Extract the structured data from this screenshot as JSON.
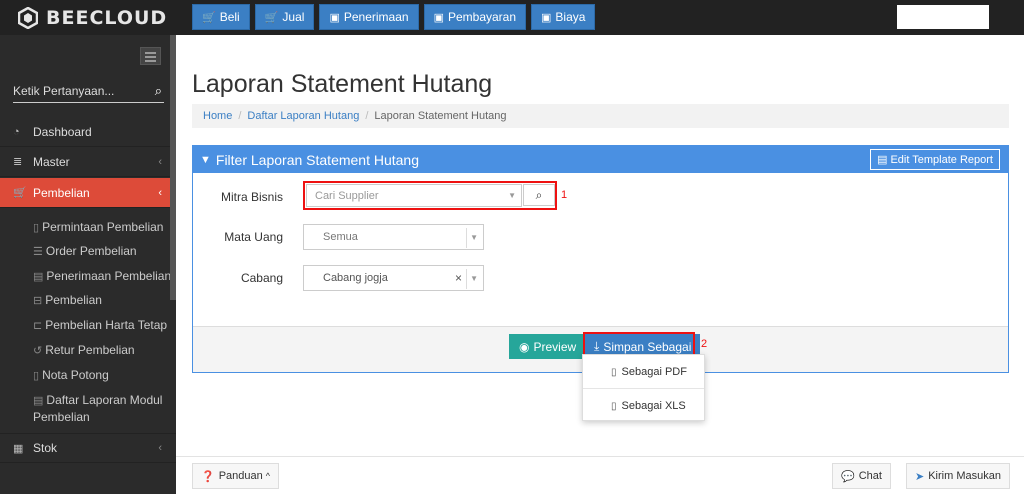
{
  "app": {
    "brand": "BEECLOUD"
  },
  "topnav": [
    {
      "label": "Beli",
      "icon": "cart-icon"
    },
    {
      "label": "Jual",
      "icon": "cart-icon"
    },
    {
      "label": "Penerimaan",
      "icon": "money-icon"
    },
    {
      "label": "Pembayaran",
      "icon": "money-icon"
    },
    {
      "label": "Biaya",
      "icon": "money-icon"
    }
  ],
  "sidebar": {
    "search_placeholder": "Ketik Pertanyaan...",
    "items": [
      {
        "label": "Dashboard",
        "icon": "tachometer-icon"
      },
      {
        "label": "Master",
        "icon": "database-icon"
      },
      {
        "label": "Pembelian",
        "icon": "cart-icon",
        "active": true
      }
    ],
    "sub_items": [
      {
        "label": "Permintaan Pembelian",
        "icon": "file-icon"
      },
      {
        "label": "Order Pembelian",
        "icon": "list-icon"
      },
      {
        "label": "Penerimaan Pembelian",
        "icon": "archive-icon"
      },
      {
        "label": "Pembelian",
        "icon": "cart-icon"
      },
      {
        "label": "Pembelian Harta Tetap",
        "icon": "car-icon"
      },
      {
        "label": "Retur Pembelian",
        "icon": "undo-icon"
      },
      {
        "label": "Nota Potong",
        "icon": "file-icon"
      },
      {
        "label": "Daftar Laporan Modul Pembelian",
        "icon": "archive-icon"
      }
    ],
    "stok": {
      "label": "Stok",
      "icon": "box-icon"
    }
  },
  "main": {
    "title": "Laporan Statement Hutang",
    "breadcrumb": [
      "Home",
      "Daftar Laporan Hutang",
      "Laporan Statement Hutang"
    ],
    "panel": {
      "title": "Filter Laporan Statement Hutang",
      "edit_label": "Edit Template Report",
      "fields": {
        "mitra_label": "Mitra Bisnis",
        "mitra_placeholder": "Cari Supplier",
        "mata_uang_label": "Mata Uang",
        "mata_uang_value": "Semua",
        "cabang_label": "Cabang",
        "cabang_value": "Cabang jogja"
      },
      "preview_label": "Preview",
      "save_label": "Simpan Sebagai",
      "dropdown": [
        "Sebagai PDF",
        "Sebagai XLS"
      ],
      "annotations": [
        "1",
        "2"
      ]
    },
    "footer": {
      "panduan": "Panduan",
      "chat": "Chat",
      "kirim": "Kirim Masukan"
    }
  },
  "colors": {
    "accent": "#3b7fc4",
    "active_menu": "#dd4b39",
    "panel_head": "#4a90e2",
    "preview": "#26a69a",
    "highlight": "#ee1111"
  }
}
